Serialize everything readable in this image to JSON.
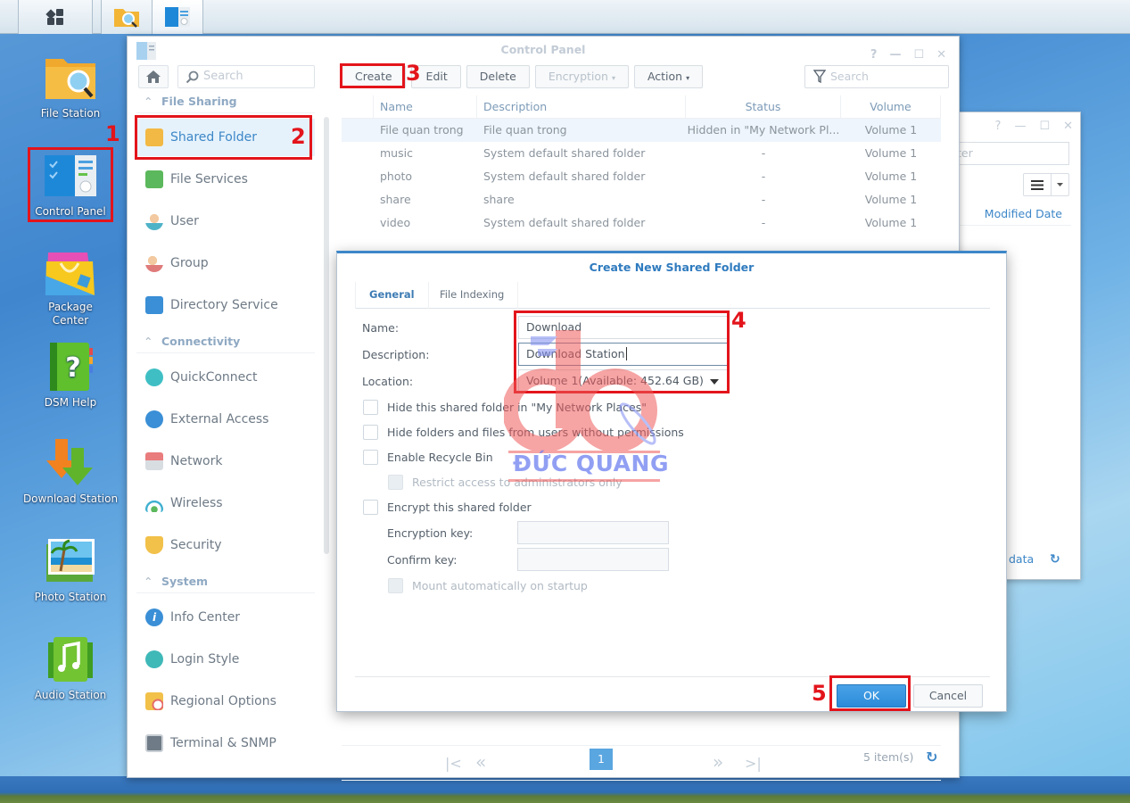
{
  "taskbar": {
    "items": [
      {
        "name": "Main Menu",
        "icon": "grid-menu-icon"
      },
      {
        "name": "File Station",
        "icon": "file-station-icon"
      },
      {
        "name": "Control Panel",
        "icon": "control-panel-icon"
      }
    ]
  },
  "desktop": {
    "icons": [
      {
        "label": "File Station",
        "icon": "folder-search-icon"
      },
      {
        "label": "Control Panel",
        "icon": "control-panel-icon"
      },
      {
        "label": "Package Center",
        "icon": "shopping-bag-icon"
      },
      {
        "label": "DSM Help",
        "icon": "help-book-icon"
      },
      {
        "label": "Download Station",
        "icon": "download-arrows-icon"
      },
      {
        "label": "Photo Station",
        "icon": "photo-icon"
      },
      {
        "label": "Audio Station",
        "icon": "music-note-icon"
      }
    ]
  },
  "annotations": {
    "step1": "1",
    "step2": "2",
    "step3": "3",
    "step4": "4",
    "step5": "5",
    "color": "#e3141b"
  },
  "control_panel": {
    "title": "Control Panel",
    "window_controls": {
      "help": "?",
      "minimize": "—",
      "maximize": "☐",
      "close": "✕"
    },
    "sidebar": {
      "search_placeholder": "Search",
      "sections": [
        {
          "title": "File Sharing",
          "items": [
            {
              "label": "Shared Folder",
              "active": true
            },
            {
              "label": "File Services"
            },
            {
              "label": "User"
            },
            {
              "label": "Group"
            },
            {
              "label": "Directory Service"
            }
          ]
        },
        {
          "title": "Connectivity",
          "items": [
            {
              "label": "QuickConnect"
            },
            {
              "label": "External Access"
            },
            {
              "label": "Network"
            },
            {
              "label": "Wireless"
            },
            {
              "label": "Security"
            }
          ]
        },
        {
          "title": "System",
          "items": [
            {
              "label": "Info Center"
            },
            {
              "label": "Login Style"
            },
            {
              "label": "Regional Options"
            },
            {
              "label": "Terminal & SNMP"
            }
          ]
        }
      ]
    },
    "toolbar": {
      "create": "Create",
      "edit": "Edit",
      "delete": "Delete",
      "encryption": "Encryption",
      "action": "Action",
      "filter_placeholder": "Search"
    },
    "table": {
      "columns": [
        "Name",
        "Description",
        "Status",
        "Volume"
      ],
      "rows": [
        {
          "name": "File quan trong",
          "description": "File quan trong",
          "status": "Hidden in \"My Network Pl...",
          "volume": "Volume 1"
        },
        {
          "name": "music",
          "description": "System default shared folder",
          "status": "-",
          "volume": "Volume 1"
        },
        {
          "name": "photo",
          "description": "System default shared folder",
          "status": "-",
          "volume": "Volume 1"
        },
        {
          "name": "share",
          "description": "share",
          "status": "-",
          "volume": "Volume 1"
        },
        {
          "name": "video",
          "description": "System default shared folder",
          "status": "-",
          "volume": "Volume 1"
        }
      ]
    },
    "pager": {
      "first": "|<",
      "prev": "«",
      "page": "1",
      "next": "»",
      "last": ">|",
      "count": "5 item(s)",
      "refresh": "↻"
    }
  },
  "file_station": {
    "window_controls": {
      "help": "?",
      "minimize": "—",
      "maximize": "☐",
      "close": "✕"
    },
    "filter_partial": "ter",
    "column": "Modified Date",
    "footer_partial": "data",
    "refresh": "↻"
  },
  "dialog": {
    "title": "Create New Shared Folder",
    "tabs": [
      "General",
      "File Indexing"
    ],
    "fields": {
      "name_label": "Name:",
      "name_value": "Download",
      "description_label": "Description:",
      "description_value": "Download Station",
      "location_label": "Location:",
      "location_value": "Volume 1(Available: 452.64 GB)"
    },
    "checkboxes": [
      {
        "label": "Hide this shared folder in \"My Network Places\"",
        "checked": false,
        "disabled": false
      },
      {
        "label": "Hide folders and files from users without permissions",
        "checked": false,
        "disabled": false
      },
      {
        "label": "Enable Recycle Bin",
        "checked": false,
        "disabled": false
      },
      {
        "label": "Restrict access to administrators only",
        "checked": false,
        "disabled": true
      },
      {
        "label": "Encrypt this shared folder",
        "checked": false,
        "disabled": false
      },
      {
        "label": "Mount automatically on startup",
        "checked": false,
        "disabled": true
      }
    ],
    "encryption_key_label": "Encryption key:",
    "confirm_key_label": "Confirm key:",
    "ok": "OK",
    "cancel": "Cancel"
  },
  "watermark": {
    "text": "ĐỨC QUANG"
  }
}
